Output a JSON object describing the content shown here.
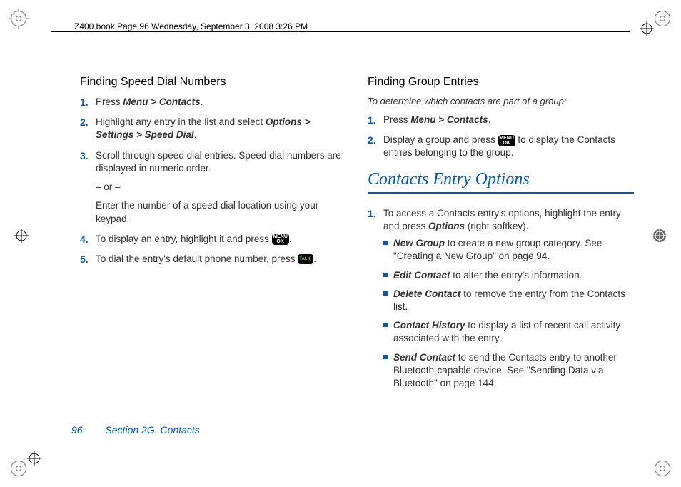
{
  "header": "Z400.book  Page 96  Wednesday, September 3, 2008  3:26 PM",
  "left": {
    "heading": "Finding Speed Dial Numbers",
    "s1_a": "Press ",
    "s1_b": "Menu > Contacts",
    "s1_c": ".",
    "s2_a": "Highlight any entry in the list and select ",
    "s2_b": "Options > Settings > Speed Dial",
    "s2_c": ".",
    "s3_a": "Scroll through speed dial entries. Speed dial numbers are displayed in numeric order.",
    "s3_b": "– or –",
    "s3_c": "Enter the number of a speed dial location using your keypad.",
    "s4_a": "To display an entry, highlight it and press ",
    "s4_b": ".",
    "s5_a": "To dial the entry's default phone number, press ",
    "s5_b": "."
  },
  "right": {
    "heading": "Finding Group Entries",
    "intro": "To determine which contacts are part of a group:",
    "g1_a": "Press ",
    "g1_b": "Menu > Contacts",
    "g1_c": ".",
    "g2_a": "Display a group and press ",
    "g2_b": " to display the Contacts entries belonging to the group.",
    "section": "Contacts Entry Options",
    "o1_a": "To access a Contacts entry's options, highlight the entry and press ",
    "o1_b": "Options",
    "o1_c": " (right softkey).",
    "opts": {
      "a_b": "New Group",
      "a_t": " to create a new group category. See \"Creating a New Group\" on page 94.",
      "b_b": "Edit Contact",
      "b_t": " to alter the entry's information.",
      "c_b": "Delete Contact",
      "c_t": " to remove the entry from the Contacts list.",
      "d_b": "Contact History",
      "d_t": " to display a list of recent call activity associated with the entry.",
      "e_b": "Send Contact",
      "e_t": " to send the Contacts entry to another Bluetooth-capable device. See \"Sending Data via Bluetooth\" on page 144."
    }
  },
  "footer": {
    "page": "96",
    "section": "Section 2G. Contacts"
  },
  "icons": {
    "menu_top": "MENU",
    "menu_bot": "OK"
  }
}
